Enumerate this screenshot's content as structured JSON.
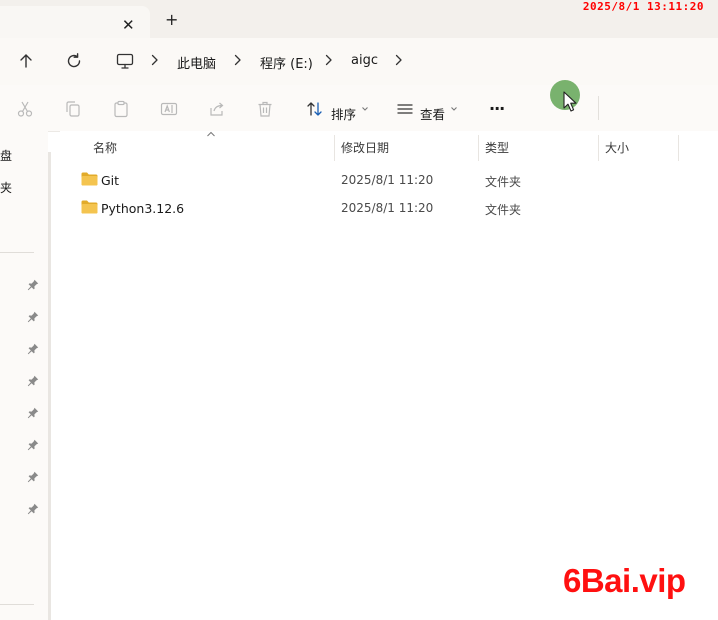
{
  "titlebar": {
    "close_glyph": "✕",
    "new_tab_glyph": "+"
  },
  "clock": "2025/8/1  13:11:20",
  "breadcrumb": [
    "此电脑",
    "程序 (E:)",
    "aigc"
  ],
  "toolbar": {
    "sort_label": "排序",
    "view_label": "查看",
    "more_label": "···"
  },
  "nav": {
    "partial_labels": [
      "盘",
      "夹"
    ],
    "pinned_count": 8
  },
  "columns": [
    "名称",
    "修改日期",
    "类型",
    "大小"
  ],
  "files": [
    {
      "name": "Git",
      "date": "2025/8/1 11:20",
      "type": "文件夹"
    },
    {
      "name": "Python3.12.6",
      "date": "2025/8/1 11:20",
      "type": "文件夹"
    }
  ],
  "watermark": "6Bai.vip",
  "colors": {
    "folder": "#f4c44f",
    "folder_dark": "#e2ab2a",
    "accent_cursor": "#6aaa5e",
    "watermark": "#ff1010",
    "clock": "#ff0000"
  },
  "icons": [
    "up-arrow-icon",
    "refresh-icon",
    "computer-icon",
    "chevron-right-icon",
    "cut-icon",
    "copy-icon",
    "paste-icon",
    "rename-icon",
    "share-icon",
    "delete-icon",
    "sort-icon",
    "view-icon",
    "more-icon",
    "pin-icon",
    "folder-icon"
  ]
}
